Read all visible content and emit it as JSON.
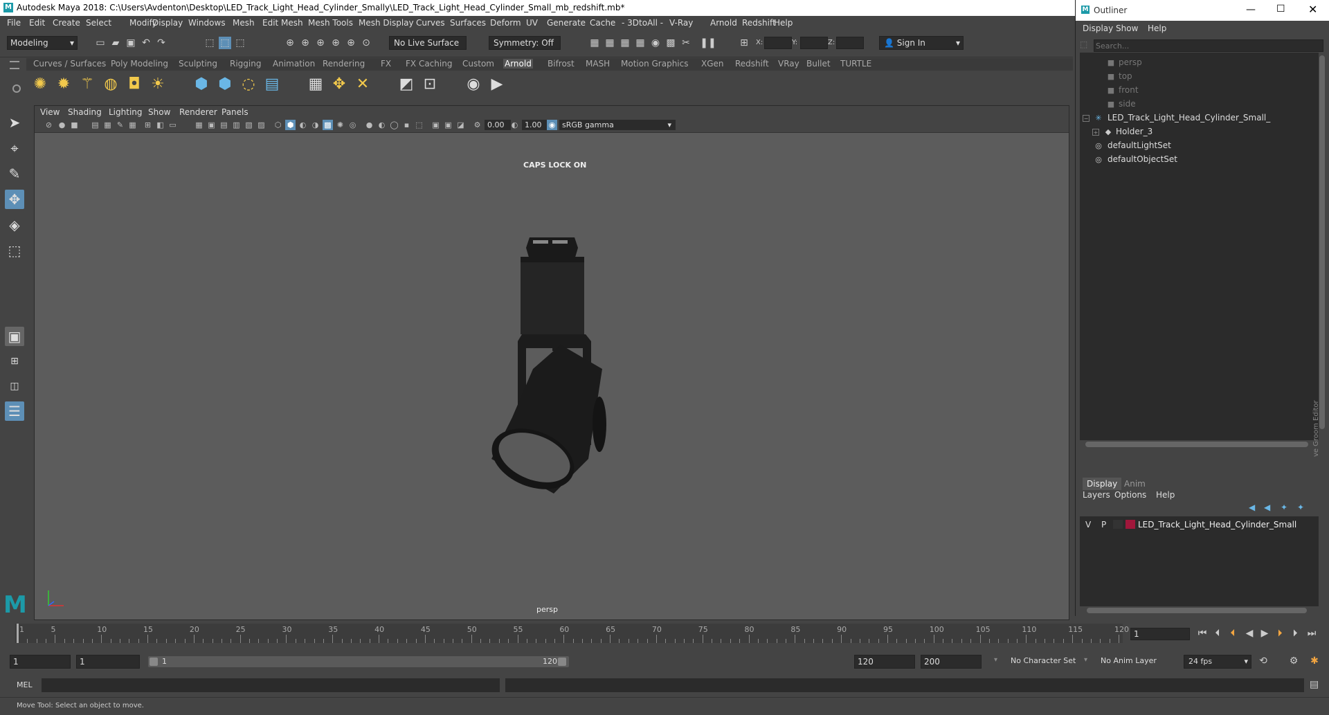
{
  "window": {
    "title": "Autodesk Maya 2018: C:\\Users\\Avdenton\\Desktop\\LED_Track_Light_Head_Cylinder_Smally\\LED_Track_Light_Head_Cylinder_Small_mb_redshift.mb*",
    "app_logo": "M"
  },
  "menubar": [
    "File",
    "Edit",
    "Create",
    "Select",
    "Modify",
    "Display",
    "Windows",
    "Mesh",
    "Edit Mesh",
    "Mesh Tools",
    "Mesh Display",
    "Curves",
    "Surfaces",
    "Deform",
    "UV",
    "Generate",
    "Cache",
    "- 3DtoAll -",
    "V-Ray",
    "Arnold",
    "Redshift",
    "Help"
  ],
  "statusline": {
    "mode": "Modeling",
    "live_surface": "No Live Surface",
    "symmetry": "Symmetry: Off",
    "x_label": "X:",
    "y_label": "Y:",
    "z_label": "Z:",
    "sign_in": "Sign In"
  },
  "shelf": {
    "tabs": [
      "Curves / Surfaces",
      "Poly Modeling",
      "Sculpting",
      "Rigging",
      "Animation",
      "Rendering",
      "FX",
      "FX Caching",
      "Custom",
      "Arnold",
      "Bifrost",
      "MASH",
      "Motion Graphics",
      "XGen",
      "Redshift",
      "VRay",
      "Bullet",
      "TURTLE"
    ],
    "active_tab": "Arnold"
  },
  "viewport": {
    "menu": [
      "View",
      "Shading",
      "Lighting",
      "Show",
      "Renderer",
      "Panels"
    ],
    "exposure": "0.00",
    "gamma": "1.00",
    "color_space": "sRGB gamma",
    "caps_lock": "CAPS LOCK ON",
    "camera": "persp"
  },
  "outliner": {
    "title": "Outliner",
    "menu": [
      "Display",
      "Show",
      "Help"
    ],
    "search_placeholder": "Search...",
    "items": [
      {
        "label": "persp",
        "icon": "camera-icon",
        "dim": true
      },
      {
        "label": "top",
        "icon": "camera-icon",
        "dim": true
      },
      {
        "label": "front",
        "icon": "camera-icon",
        "dim": true
      },
      {
        "label": "side",
        "icon": "camera-icon",
        "dim": true
      },
      {
        "label": "LED_Track_Light_Head_Cylinder_Small_",
        "icon": "transform-icon",
        "dim": false
      },
      {
        "label": "Holder_3",
        "icon": "mesh-icon",
        "dim": false
      },
      {
        "label": "defaultLightSet",
        "icon": "set-icon",
        "dim": false
      },
      {
        "label": "defaultObjectSet",
        "icon": "set-icon",
        "dim": false
      }
    ]
  },
  "layer_editor": {
    "tabs": [
      "Display",
      "Anim"
    ],
    "menu": [
      "Layers",
      "Options",
      "Help"
    ],
    "layer": {
      "v": "V",
      "p": "P",
      "name": "LED_Track_Light_Head_Cylinder_Small",
      "color": "#a0173b"
    }
  },
  "timeline": {
    "ticks": [
      "1",
      "5",
      "10",
      "15",
      "20",
      "25",
      "30",
      "35",
      "40",
      "45",
      "50",
      "55",
      "60",
      "65",
      "70",
      "75",
      "80",
      "85",
      "90",
      "95",
      "100",
      "105",
      "110",
      "115",
      "120"
    ],
    "current_frame": "1"
  },
  "range": {
    "start": "1",
    "anim_start": "1",
    "range_start": "1",
    "range_end": "120",
    "end": "120",
    "anim_end": "200",
    "character_set": "No Character Set",
    "anim_layer": "No Anim Layer",
    "fps": "24 fps"
  },
  "command": {
    "mel_label": "MEL"
  },
  "help_line": "Move Tool: Select an object to move.",
  "side_label": "ve Groom Editor"
}
